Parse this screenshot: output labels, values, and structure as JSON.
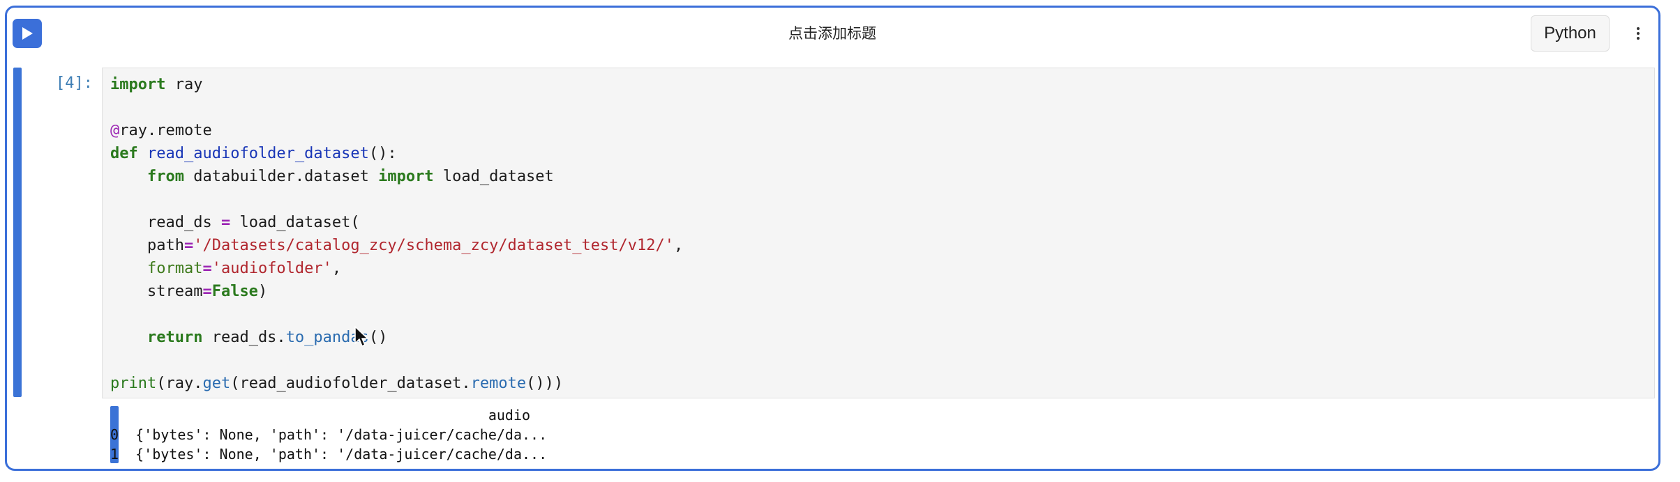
{
  "cell": {
    "title": "点击添加标题",
    "kernel": "Python",
    "prompt": "[4]:",
    "run_icon": "play-icon",
    "more_icon": "more-vertical-icon"
  },
  "code_lines": [
    [
      {
        "t": "import",
        "c": "kw"
      },
      {
        "t": " ray"
      }
    ],
    [],
    [
      {
        "t": "@",
        "c": "deco"
      },
      {
        "t": "ray.remote"
      }
    ],
    [
      {
        "t": "def",
        "c": "kw"
      },
      {
        "t": " "
      },
      {
        "t": "read_audiofolder_dataset",
        "c": "fn"
      },
      {
        "t": "():"
      }
    ],
    [
      {
        "t": "    "
      },
      {
        "t": "from",
        "c": "kw"
      },
      {
        "t": " databuilder.dataset "
      },
      {
        "t": "import",
        "c": "kw"
      },
      {
        "t": " load_dataset"
      }
    ],
    [],
    [
      {
        "t": "    read_ds "
      },
      {
        "t": "=",
        "c": "op"
      },
      {
        "t": " load_dataset("
      }
    ],
    [
      {
        "t": "    path"
      },
      {
        "t": "=",
        "c": "op"
      },
      {
        "t": "'/Datasets/catalog_zcy/schema_zcy/dataset_test/v12/'",
        "c": "str"
      },
      {
        "t": ","
      }
    ],
    [
      {
        "t": "    "
      },
      {
        "t": "format",
        "c": "param"
      },
      {
        "t": "=",
        "c": "op"
      },
      {
        "t": "'audiofolder'",
        "c": "str"
      },
      {
        "t": ","
      }
    ],
    [
      {
        "t": "    stream"
      },
      {
        "t": "=",
        "c": "op"
      },
      {
        "t": "False",
        "c": "kw"
      },
      {
        "t": ")"
      }
    ],
    [],
    [
      {
        "t": "    "
      },
      {
        "t": "return",
        "c": "kw"
      },
      {
        "t": " read_ds."
      },
      {
        "t": "to_pandas",
        "c": "attr"
      },
      {
        "t": "()"
      }
    ],
    [],
    [
      {
        "t": "print",
        "c": "builtin"
      },
      {
        "t": "(ray."
      },
      {
        "t": "get",
        "c": "attr"
      },
      {
        "t": "(read_audiofolder_dataset."
      },
      {
        "t": "remote",
        "c": "attr"
      },
      {
        "t": "()))"
      }
    ]
  ],
  "output": {
    "lines": [
      "                                             audio",
      "0  {'bytes': None, 'path': '/data-juicer/cache/da...",
      "1  {'bytes': None, 'path': '/data-juicer/cache/da..."
    ]
  }
}
